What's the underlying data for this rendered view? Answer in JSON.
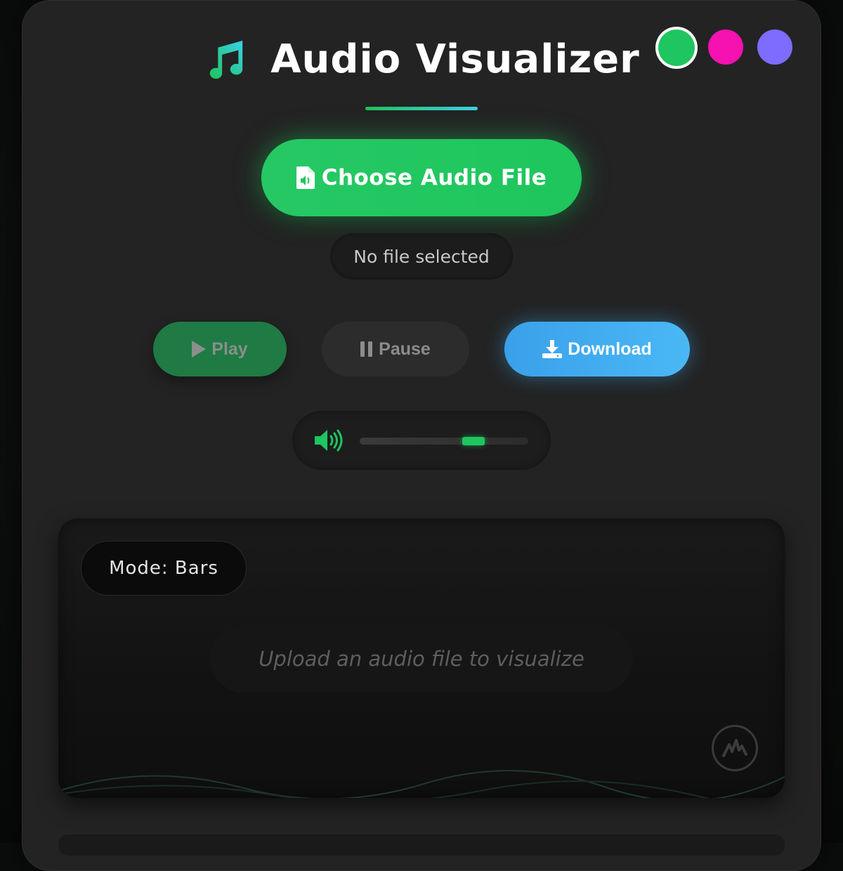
{
  "header": {
    "title": "Audio Visualizer",
    "icon": "music-note-icon",
    "accent_gradient": [
      "#1ec45a",
      "#3ad1e6"
    ]
  },
  "themes": [
    {
      "name": "green",
      "color": "#1fc55f",
      "selected": true
    },
    {
      "name": "pink",
      "color": "#f512b0",
      "selected": false
    },
    {
      "name": "purple",
      "color": "#7e6bff",
      "selected": false
    }
  ],
  "file": {
    "choose_label": "Choose Audio File",
    "choose_icon": "file-audio-icon",
    "status": "No file selected"
  },
  "controls": {
    "play_label": "Play",
    "play_icon": "play-icon",
    "pause_label": "Pause",
    "pause_icon": "pause-icon",
    "download_label": "Download",
    "download_icon": "download-icon"
  },
  "volume": {
    "icon": "volume-icon",
    "level": 0.7
  },
  "visualizer": {
    "mode_label": "Mode: Bars",
    "placeholder": "Upload an audio file to visualize",
    "badge_icon": "waveform-logo-icon"
  }
}
